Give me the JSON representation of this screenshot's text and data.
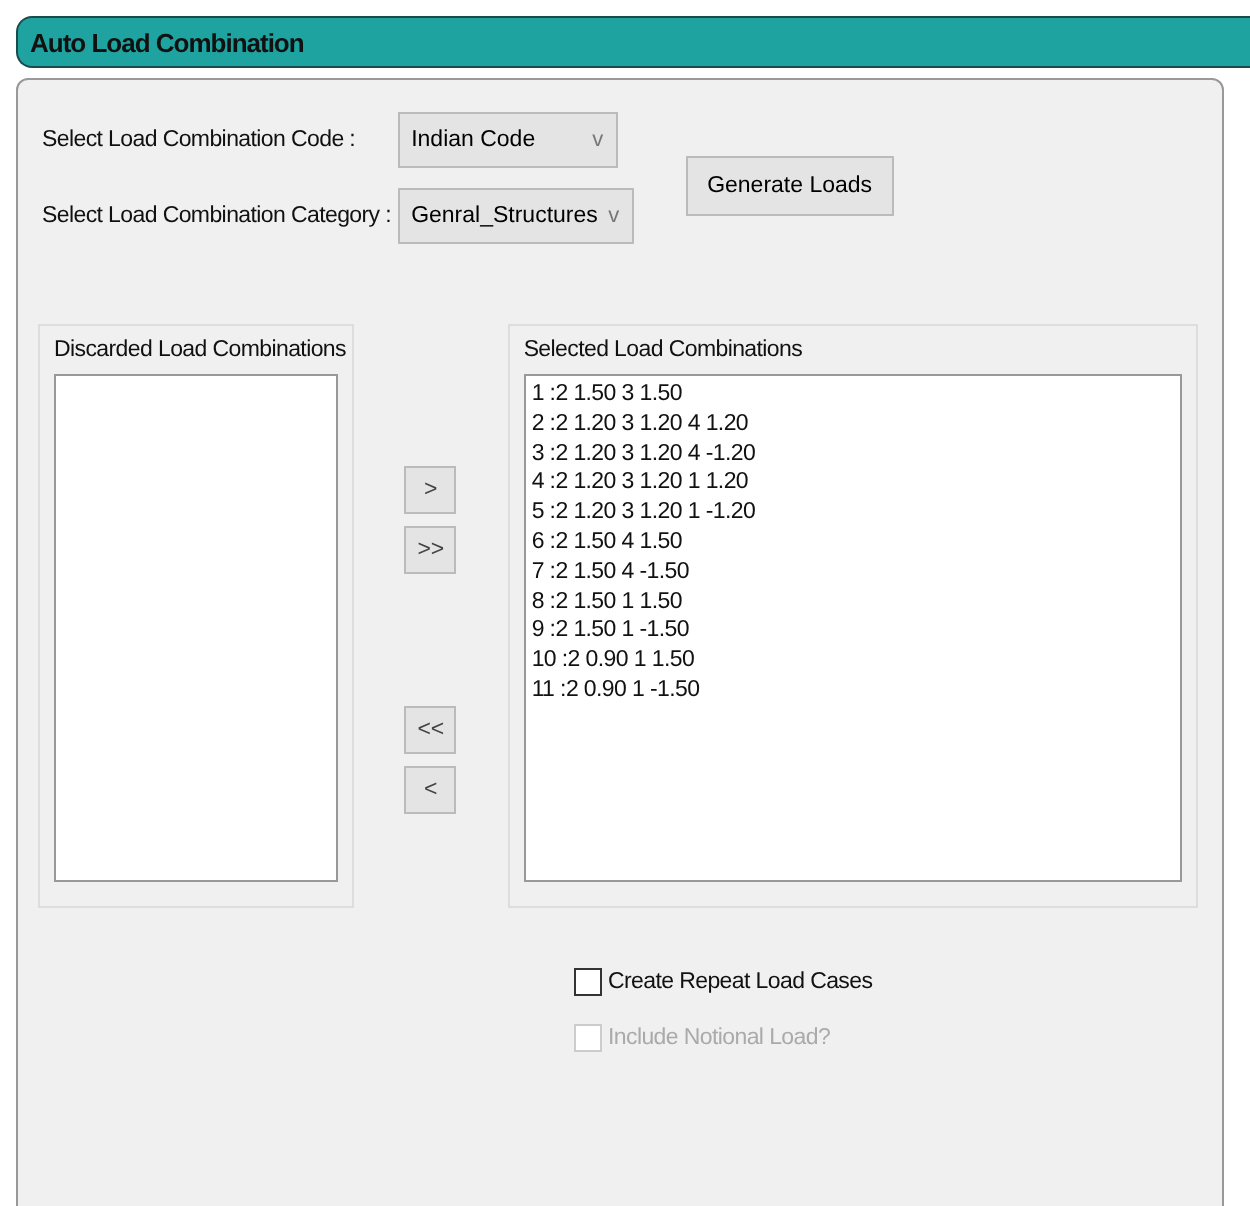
{
  "window": {
    "title": "Auto Load Combination"
  },
  "code": {
    "label": "Select Load Combination Code :",
    "value": "Indian Code",
    "arrow": "v"
  },
  "category": {
    "label": "Select Load Combination Category :",
    "value": "Genral_Structures",
    "arrow": "v"
  },
  "generate_button": "Generate Loads",
  "discarded": {
    "title": "Discarded Load Combinations"
  },
  "move_buttons": [
    {
      "label": ">",
      "kind": "move"
    },
    {
      "label": ">>",
      "kind": "move"
    },
    {
      "label": "<<",
      "kind": "move"
    },
    {
      "label": "<",
      "kind": "move"
    }
  ],
  "selected": {
    "title": "Selected Load Combinations",
    "items": [
      "1 :2 1.50 3 1.50",
      "2 :2 1.20 3 1.20 4 1.20",
      "3 :2 1.20 3 1.20 4 -1.20",
      "4 :2 1.20 3 1.20 1 1.20",
      "5 :2 1.20 3 1.20 1 -1.20",
      "6 :2 1.50 4 1.50",
      "7 :2 1.50 4 -1.50",
      "8 :2 1.50 1 1.50",
      "9 :2 1.50 1 -1.50",
      "10 :2 0.90 1 1.50",
      "11 :2 0.90 1 -1.50"
    ]
  },
  "options": [
    {
      "label": "Create Repeat Load Cases",
      "checked": false,
      "disabled": false
    },
    {
      "label": "Include Notional Load?",
      "checked": false,
      "disabled": true
    }
  ]
}
